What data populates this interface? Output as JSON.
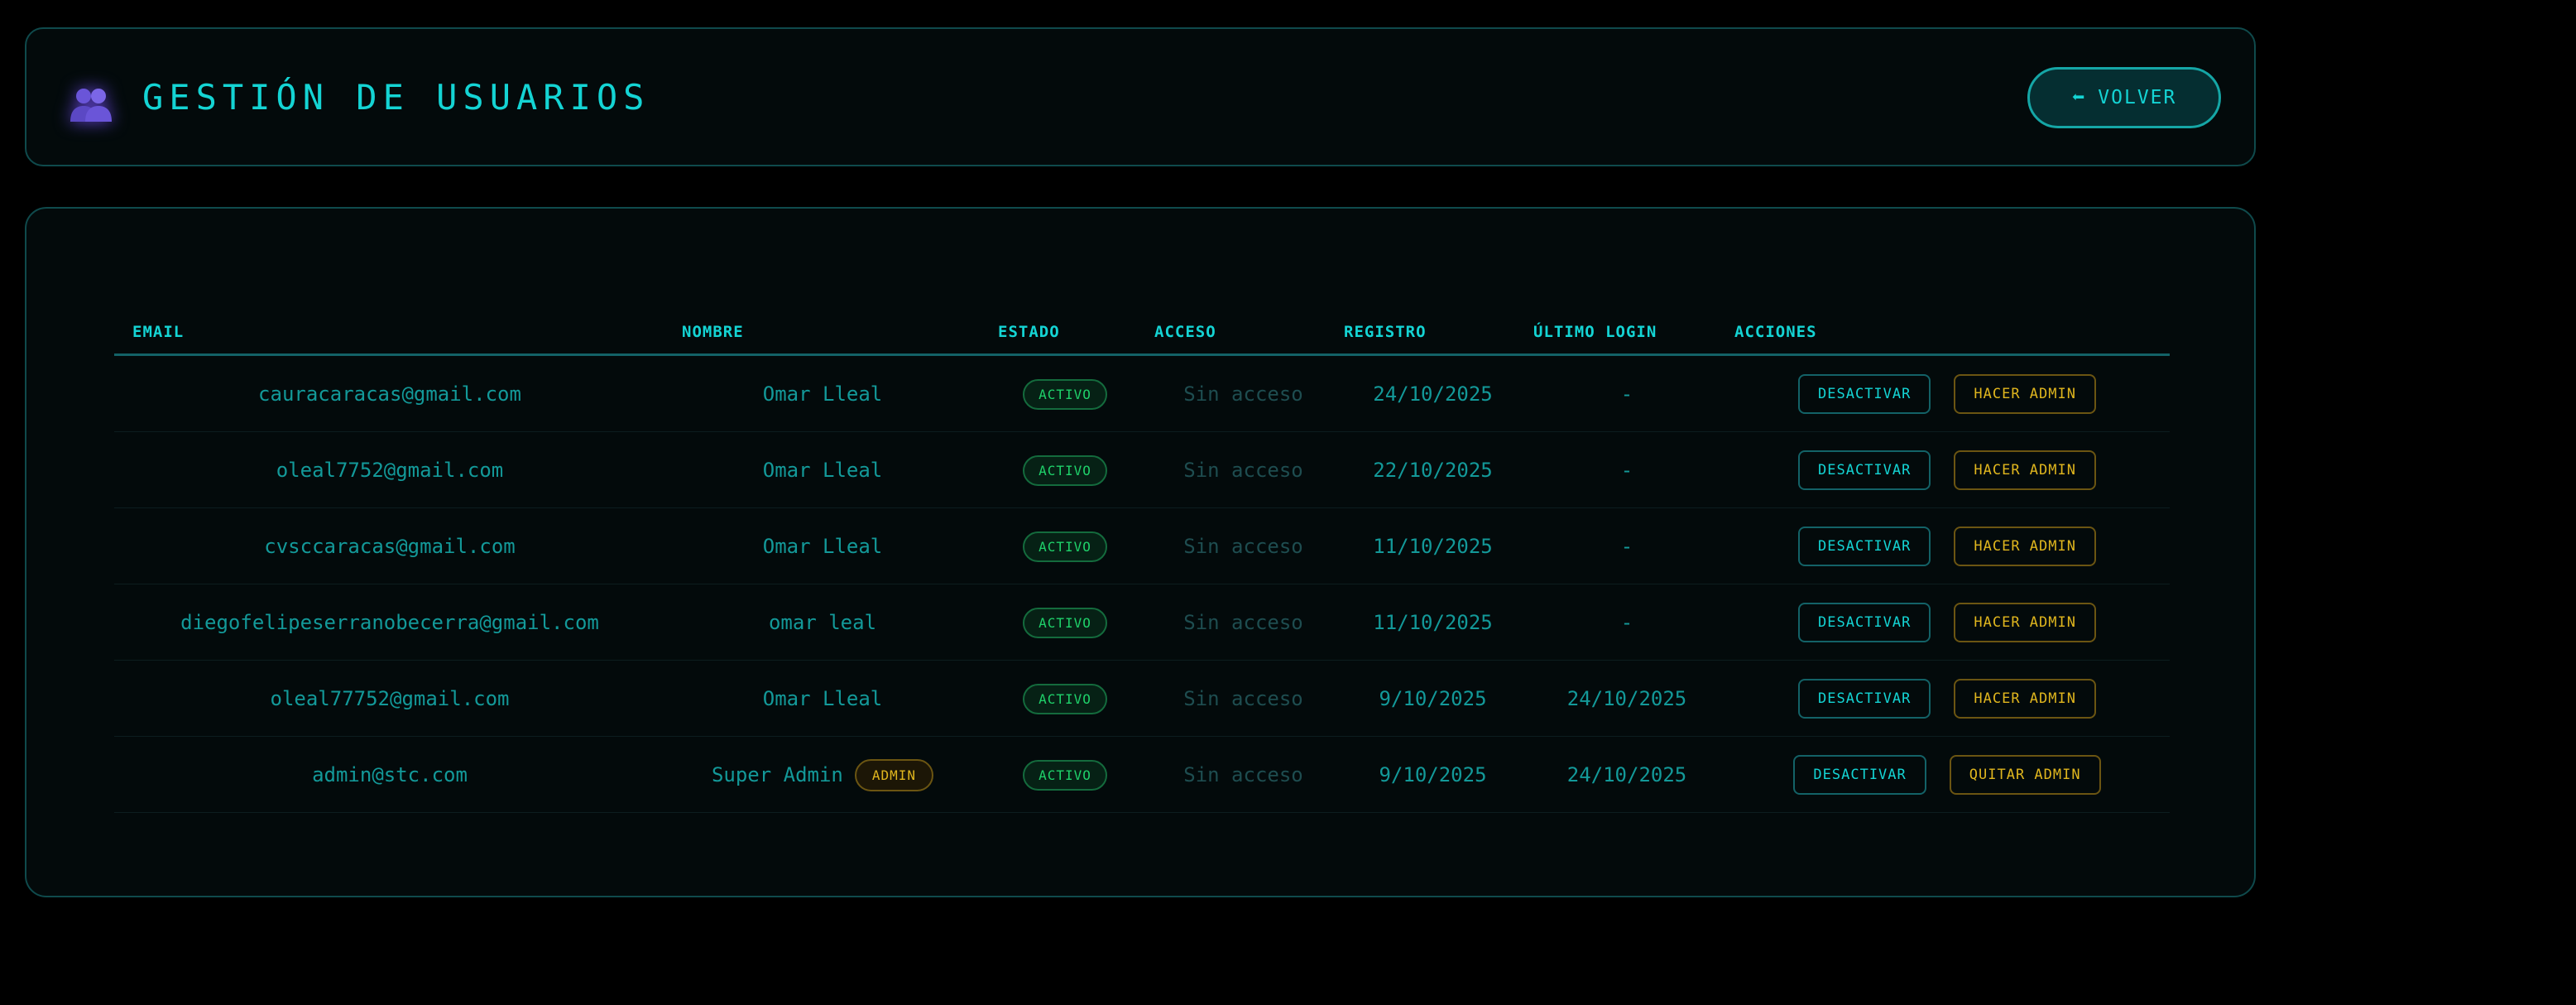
{
  "header": {
    "title": "GESTIÓN DE USUARIOS",
    "back_label": "VOLVER",
    "back_icon": "⬅"
  },
  "table": {
    "columns": {
      "email": "EMAIL",
      "nombre": "NOMBRE",
      "estado": "ESTADO",
      "acceso": "ACCESO",
      "registro": "REGISTRO",
      "ultimo_login": "ÚLTIMO LOGIN",
      "acciones": "ACCIONES"
    },
    "rows": [
      {
        "email": "cauracaracas@gmail.com",
        "nombre": "Omar Lleal",
        "role_badge": "",
        "estado": "ACTIVO",
        "acceso": "Sin acceso",
        "registro": "24/10/2025",
        "ultimo_login": "-",
        "action1": "DESACTIVAR",
        "action2": "HACER ADMIN"
      },
      {
        "email": "oleal7752@gmail.com",
        "nombre": "Omar Lleal",
        "role_badge": "",
        "estado": "ACTIVO",
        "acceso": "Sin acceso",
        "registro": "22/10/2025",
        "ultimo_login": "-",
        "action1": "DESACTIVAR",
        "action2": "HACER ADMIN"
      },
      {
        "email": "cvsccaracas@gmail.com",
        "nombre": "Omar Lleal",
        "role_badge": "",
        "estado": "ACTIVO",
        "acceso": "Sin acceso",
        "registro": "11/10/2025",
        "ultimo_login": "-",
        "action1": "DESACTIVAR",
        "action2": "HACER ADMIN"
      },
      {
        "email": "diegofelipeserranobecerra@gmail.com",
        "nombre": "omar leal",
        "role_badge": "",
        "estado": "ACTIVO",
        "acceso": "Sin acceso",
        "registro": "11/10/2025",
        "ultimo_login": "-",
        "action1": "DESACTIVAR",
        "action2": "HACER ADMIN"
      },
      {
        "email": "oleal77752@gmail.com",
        "nombre": "Omar Lleal",
        "role_badge": "",
        "estado": "ACTIVO",
        "acceso": "Sin acceso",
        "registro": "9/10/2025",
        "ultimo_login": "24/10/2025",
        "action1": "DESACTIVAR",
        "action2": "HACER ADMIN"
      },
      {
        "email": "admin@stc.com",
        "nombre": "Super Admin",
        "role_badge": "ADMIN",
        "estado": "ACTIVO",
        "acceso": "Sin acceso",
        "registro": "9/10/2025",
        "ultimo_login": "24/10/2025",
        "action1": "DESACTIVAR",
        "action2": "QUITAR ADMIN"
      }
    ]
  },
  "icons": {
    "title_icon": "users-icon",
    "back_icon": "arrow-left-icon"
  },
  "colors": {
    "accent": "#14d4d4",
    "text_muted": "#139999",
    "success": "#1fd16a",
    "warning": "#e0b61e",
    "panel_border": "#0f4a4c",
    "background": "#000000"
  }
}
